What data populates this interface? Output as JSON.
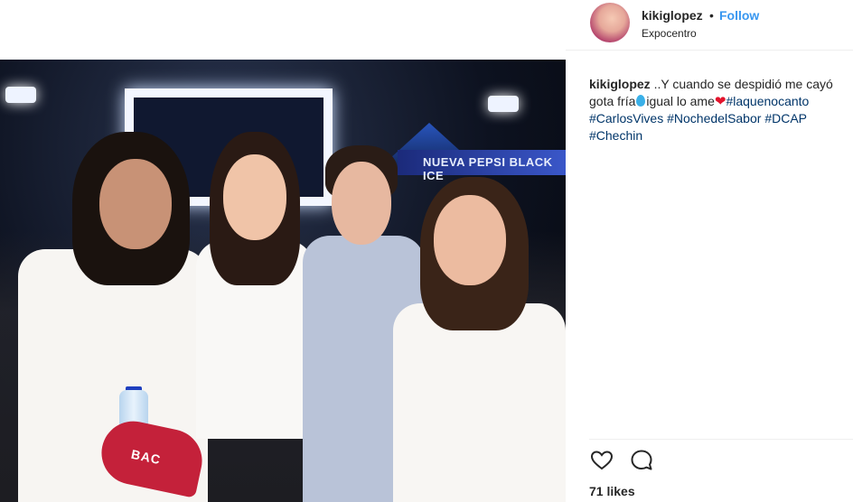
{
  "header": {
    "username": "kikiglopez",
    "separator": "•",
    "follow_label": "Follow",
    "location": "Expocentro"
  },
  "photo": {
    "stage_sign_text": "NUEVA PEPSI BLACK ICE",
    "fan_text": "BAC"
  },
  "caption": {
    "username": "kikiglopez",
    "text_part1": "..Y cuando se despidió me cayó gota fría",
    "text_part2": "igual lo ame",
    "hashtags": [
      "#laquenocanto",
      "#CarlosVives",
      "#NochedelSabor",
      "#DCAP",
      "#Chechin"
    ]
  },
  "actions": {
    "like_icon": "heart-icon",
    "comment_icon": "comment-icon"
  },
  "likes_text": "71 likes",
  "colors": {
    "link": "#3897f0",
    "hashtag": "#003569",
    "text": "#262626"
  }
}
